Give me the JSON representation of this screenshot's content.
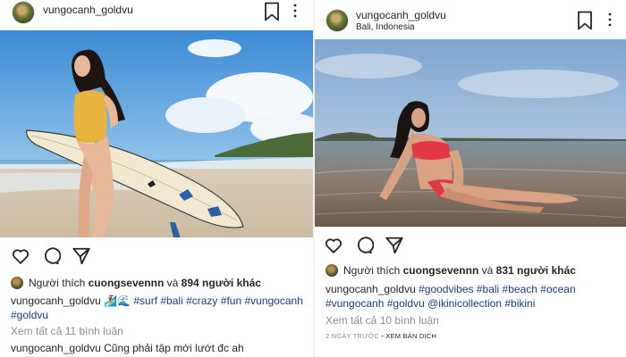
{
  "posts": [
    {
      "username": "vungocanh_goldvu",
      "location": "",
      "likes": {
        "prefix": "Người thích",
        "user": "cuongsevennn",
        "connector": "và",
        "others": "894 người khác"
      },
      "caption": {
        "author": "vungocanh_goldvu",
        "emoji": "🏄‍♀️🌊",
        "tags": [
          "#surf",
          "#bali",
          "#crazy",
          "#fun",
          "#vungocanh",
          "#goldvu"
        ]
      },
      "view_comments": "Xem tất cả 11 bình luận",
      "comment": {
        "author": "vungocanh_goldvu",
        "text": "Cũng phải tập mới lướt đc ah"
      },
      "icons": {
        "like": "heart-icon",
        "comment": "comment-icon",
        "share": "send-icon",
        "save": "bookmark-icon",
        "more": "more-vertical-icon"
      }
    },
    {
      "username": "vungocanh_goldvu",
      "location": "Bali, Indonesia",
      "likes": {
        "prefix": "Người thích",
        "user": "cuongsevennn",
        "connector": "và",
        "others": "831 người khác"
      },
      "caption": {
        "author": "vungocanh_goldvu",
        "tags": [
          "#goodvibes",
          "#bali",
          "#beach",
          "#ocean",
          "#vungocanh",
          "#goldvu",
          "@ikinicollection",
          "#bikini"
        ]
      },
      "view_comments": "Xem tất cả 10 bình luận",
      "timestamp": "2 NGÀY TRƯỚC",
      "separator": "•",
      "translate": "XEM BẢN DỊCH",
      "icons": {
        "like": "heart-icon",
        "comment": "comment-icon",
        "share": "send-icon",
        "save": "bookmark-icon",
        "more": "more-vertical-icon"
      }
    }
  ],
  "colors": {
    "hashtag": "#1a3e7a",
    "muted": "#8e8e8e",
    "text": "#262626"
  }
}
